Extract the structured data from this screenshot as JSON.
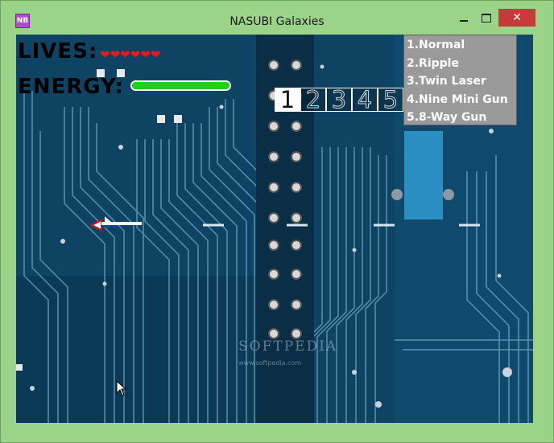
{
  "window": {
    "title": "NASUBI Galaxies",
    "icon_label": "NB",
    "controls": {
      "close": "✕"
    }
  },
  "hud": {
    "lives_label": "LIVES:",
    "lives_count": 6,
    "energy_label": "ENERGY:",
    "energy_level": 1.0
  },
  "weapon_slots": {
    "digits": [
      "1",
      "2",
      "3",
      "4",
      "5"
    ],
    "selected": "1"
  },
  "weapons": [
    "1.Normal",
    "2.Ripple",
    "3.Twin Laser",
    "4.Nine Mini Gun",
    "5.8-Way Gun"
  ],
  "watermark": {
    "text": "SOFTPEDIA",
    "url": "www.softpedia.com"
  },
  "colors": {
    "frame": "#9bd389",
    "board": "#0d4160",
    "trace": "#7fb4cf",
    "heart": "#e41b1b",
    "energy": "#20d020",
    "menu_bg": "#9a9a9a",
    "close_button": "#c83a3a"
  },
  "icons": {
    "app": "app-icon",
    "heart": "heart-icon",
    "player": "player-ship-icon",
    "cursor": "mouse-cursor-icon"
  }
}
